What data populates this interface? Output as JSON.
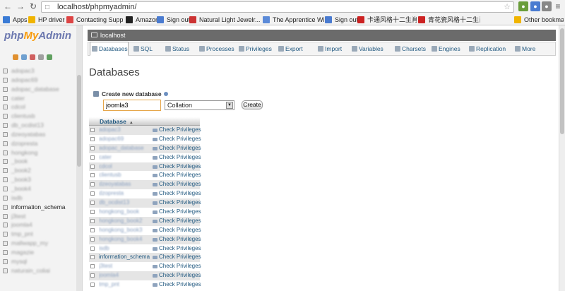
{
  "browser": {
    "url": "localhost/phpmyadmin/",
    "bookmarks": [
      {
        "label": "Apps",
        "color": "#3a7bd5"
      },
      {
        "label": "HP drivers",
        "color": "#f0b400"
      },
      {
        "label": "Contacting Support ...",
        "color": "#d44"
      },
      {
        "label": "Amazon",
        "color": "#222"
      },
      {
        "label": "Sign out",
        "color": "#4a7bd0"
      },
      {
        "label": "Natural Light Jewelr...",
        "color": "#c33"
      },
      {
        "label": "The Apprentice Win...",
        "color": "#5b8ad8"
      },
      {
        "label": "Sign out",
        "color": "#4a7bd0"
      },
      {
        "label": "卡通风格十二生肖图...",
        "color": "#c22"
      },
      {
        "label": "青花瓷风格十二生肖...",
        "color": "#c22"
      }
    ],
    "other_bookmarks": "Other bookmarks"
  },
  "logo": {
    "php": "php",
    "my": "My",
    "admin": "Admin"
  },
  "sidebar": {
    "databases": [
      {
        "name": "adopac3",
        "blurred": true
      },
      {
        "name": "adopac69",
        "blurred": true
      },
      {
        "name": "adopac_database",
        "blurred": true
      },
      {
        "name": "cater",
        "blurred": true
      },
      {
        "name": "cdcol",
        "blurred": true
      },
      {
        "name": "clientusb",
        "blurred": true
      },
      {
        "name": "db_ocdist13",
        "blurred": true
      },
      {
        "name": "dzeoyatabas",
        "blurred": true
      },
      {
        "name": "dzopresta",
        "blurred": true
      },
      {
        "name": "hongkong",
        "blurred": true
      },
      {
        "name": "_book",
        "blurred": true
      },
      {
        "name": "_book2",
        "blurred": true
      },
      {
        "name": "_book3",
        "blurred": true
      },
      {
        "name": "_book4",
        "blurred": true
      },
      {
        "name": "isdb",
        "blurred": true
      },
      {
        "name": "information_schema",
        "blurred": false
      },
      {
        "name": "j3test",
        "blurred": true
      },
      {
        "name": "joomla4",
        "blurred": true
      },
      {
        "name": "tmp_pnt",
        "blurred": true
      },
      {
        "name": "mallwapp_my",
        "blurred": true
      },
      {
        "name": "magazie",
        "blurred": true
      },
      {
        "name": "mysql",
        "blurred": true
      },
      {
        "name": "naturain_coliai",
        "blurred": true
      }
    ]
  },
  "server": {
    "label": "localhost"
  },
  "tabs": [
    {
      "label": "Databases",
      "active": true
    },
    {
      "label": "SQL",
      "active": false
    },
    {
      "label": "Status",
      "active": false
    },
    {
      "label": "Processes",
      "active": false
    },
    {
      "label": "Privileges",
      "active": false
    },
    {
      "label": "Export",
      "active": false
    },
    {
      "label": "Import",
      "active": false
    },
    {
      "label": "Variables",
      "active": false
    },
    {
      "label": "Charsets",
      "active": false
    },
    {
      "label": "Engines",
      "active": false
    },
    {
      "label": "Replication",
      "active": false
    },
    {
      "label": "More",
      "active": false
    }
  ],
  "page": {
    "title": "Databases",
    "create_label": "Create new database",
    "db_name_value": "joomla3",
    "collation_value": "Collation",
    "create_button": "Create"
  },
  "table": {
    "header": "Database",
    "privileges_label": "Check Privileges",
    "rows": [
      {
        "name": "adopac3",
        "blurred": true
      },
      {
        "name": "adopac69",
        "blurred": true
      },
      {
        "name": "adopac_database",
        "blurred": true
      },
      {
        "name": "cater",
        "blurred": true
      },
      {
        "name": "cdcol",
        "blurred": true
      },
      {
        "name": "clientusb",
        "blurred": true
      },
      {
        "name": "dzeoyatabas",
        "blurred": true
      },
      {
        "name": "dzopresta",
        "blurred": true
      },
      {
        "name": "db_ocdist13",
        "blurred": true
      },
      {
        "name": "hongkong_book",
        "blurred": true
      },
      {
        "name": "hongkong_book2",
        "blurred": true
      },
      {
        "name": "hongkong_book3",
        "blurred": true
      },
      {
        "name": "hongkong_book4",
        "blurred": true
      },
      {
        "name": "isdb",
        "blurred": true
      },
      {
        "name": "information_schema",
        "blurred": false
      },
      {
        "name": "j3test",
        "blurred": true
      },
      {
        "name": "joomla4",
        "blurred": true
      },
      {
        "name": "tmp_pnt",
        "blurred": true
      }
    ]
  }
}
